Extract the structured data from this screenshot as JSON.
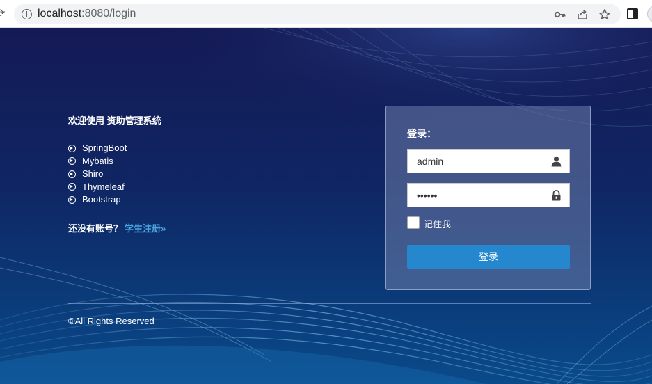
{
  "browser": {
    "url_host": "localhost",
    "url_rest": ":8080/login"
  },
  "intro": {
    "welcome": "欢迎使用 资助管理系统",
    "tech_items": [
      "SpringBoot",
      "Mybatis",
      "Shiro",
      "Thymeleaf",
      "Bootstrap"
    ],
    "register_prompt": "还没有账号？",
    "register_link": "学生注册»"
  },
  "login": {
    "title": "登录：",
    "username_value": "admin",
    "password_value": "••••••",
    "remember_label": "记住我",
    "remember_checked": false,
    "submit_label": "登录"
  },
  "footer": {
    "copyright": "©All Rights Reserved"
  },
  "colors": {
    "button": "#2588cf",
    "link": "#4aa3e0",
    "background": "#0f2664"
  }
}
